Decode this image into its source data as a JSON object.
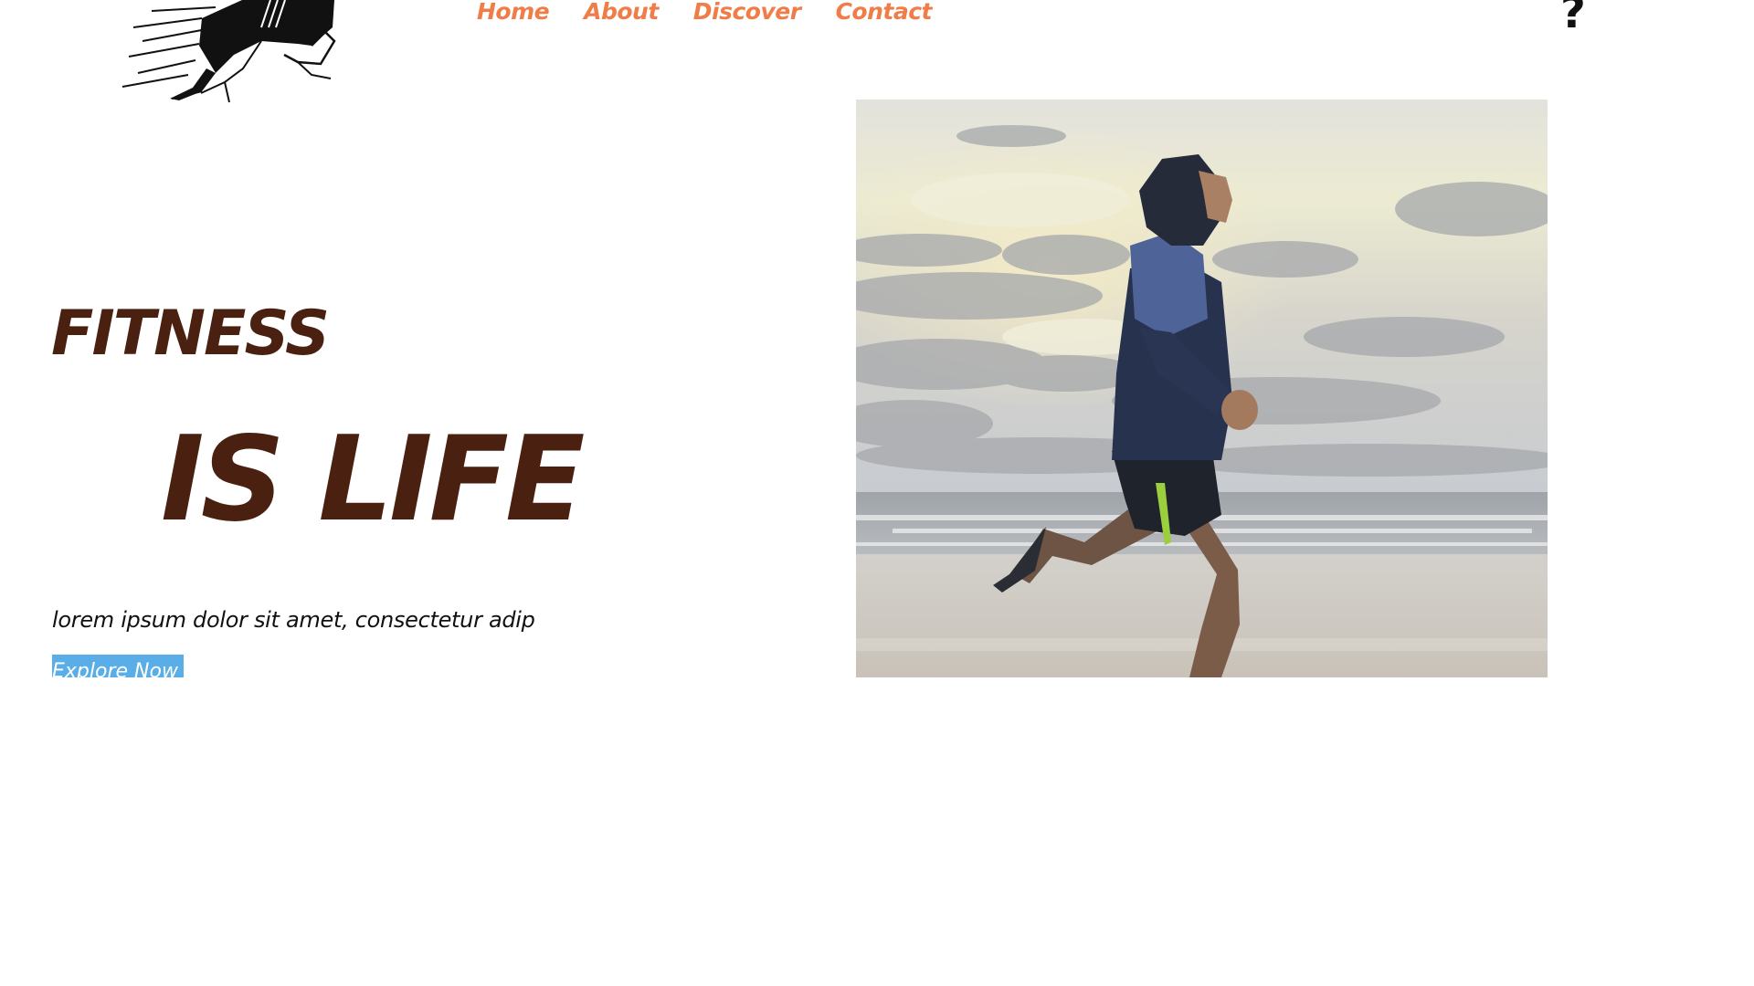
{
  "nav": {
    "items": [
      {
        "label": "Home"
      },
      {
        "label": "About"
      },
      {
        "label": "Discover"
      },
      {
        "label": "Contact"
      }
    ]
  },
  "header": {
    "help_icon": "?"
  },
  "hero": {
    "headline_line1": "FITNESS",
    "headline_line2": "IS LIFE",
    "tagline": "lorem ipsum dolor sit amet, consectetur adip",
    "cta_label": "Explore Now",
    "image_subject": "runner-on-beach-photo"
  },
  "colors": {
    "nav_accent": "#f07c48",
    "headline": "#4a2010",
    "cta_background": "#5aaee8",
    "background": "#ffffff"
  },
  "icons": {
    "logo": "sprinter-logo-icon",
    "help": "question-mark-icon"
  }
}
